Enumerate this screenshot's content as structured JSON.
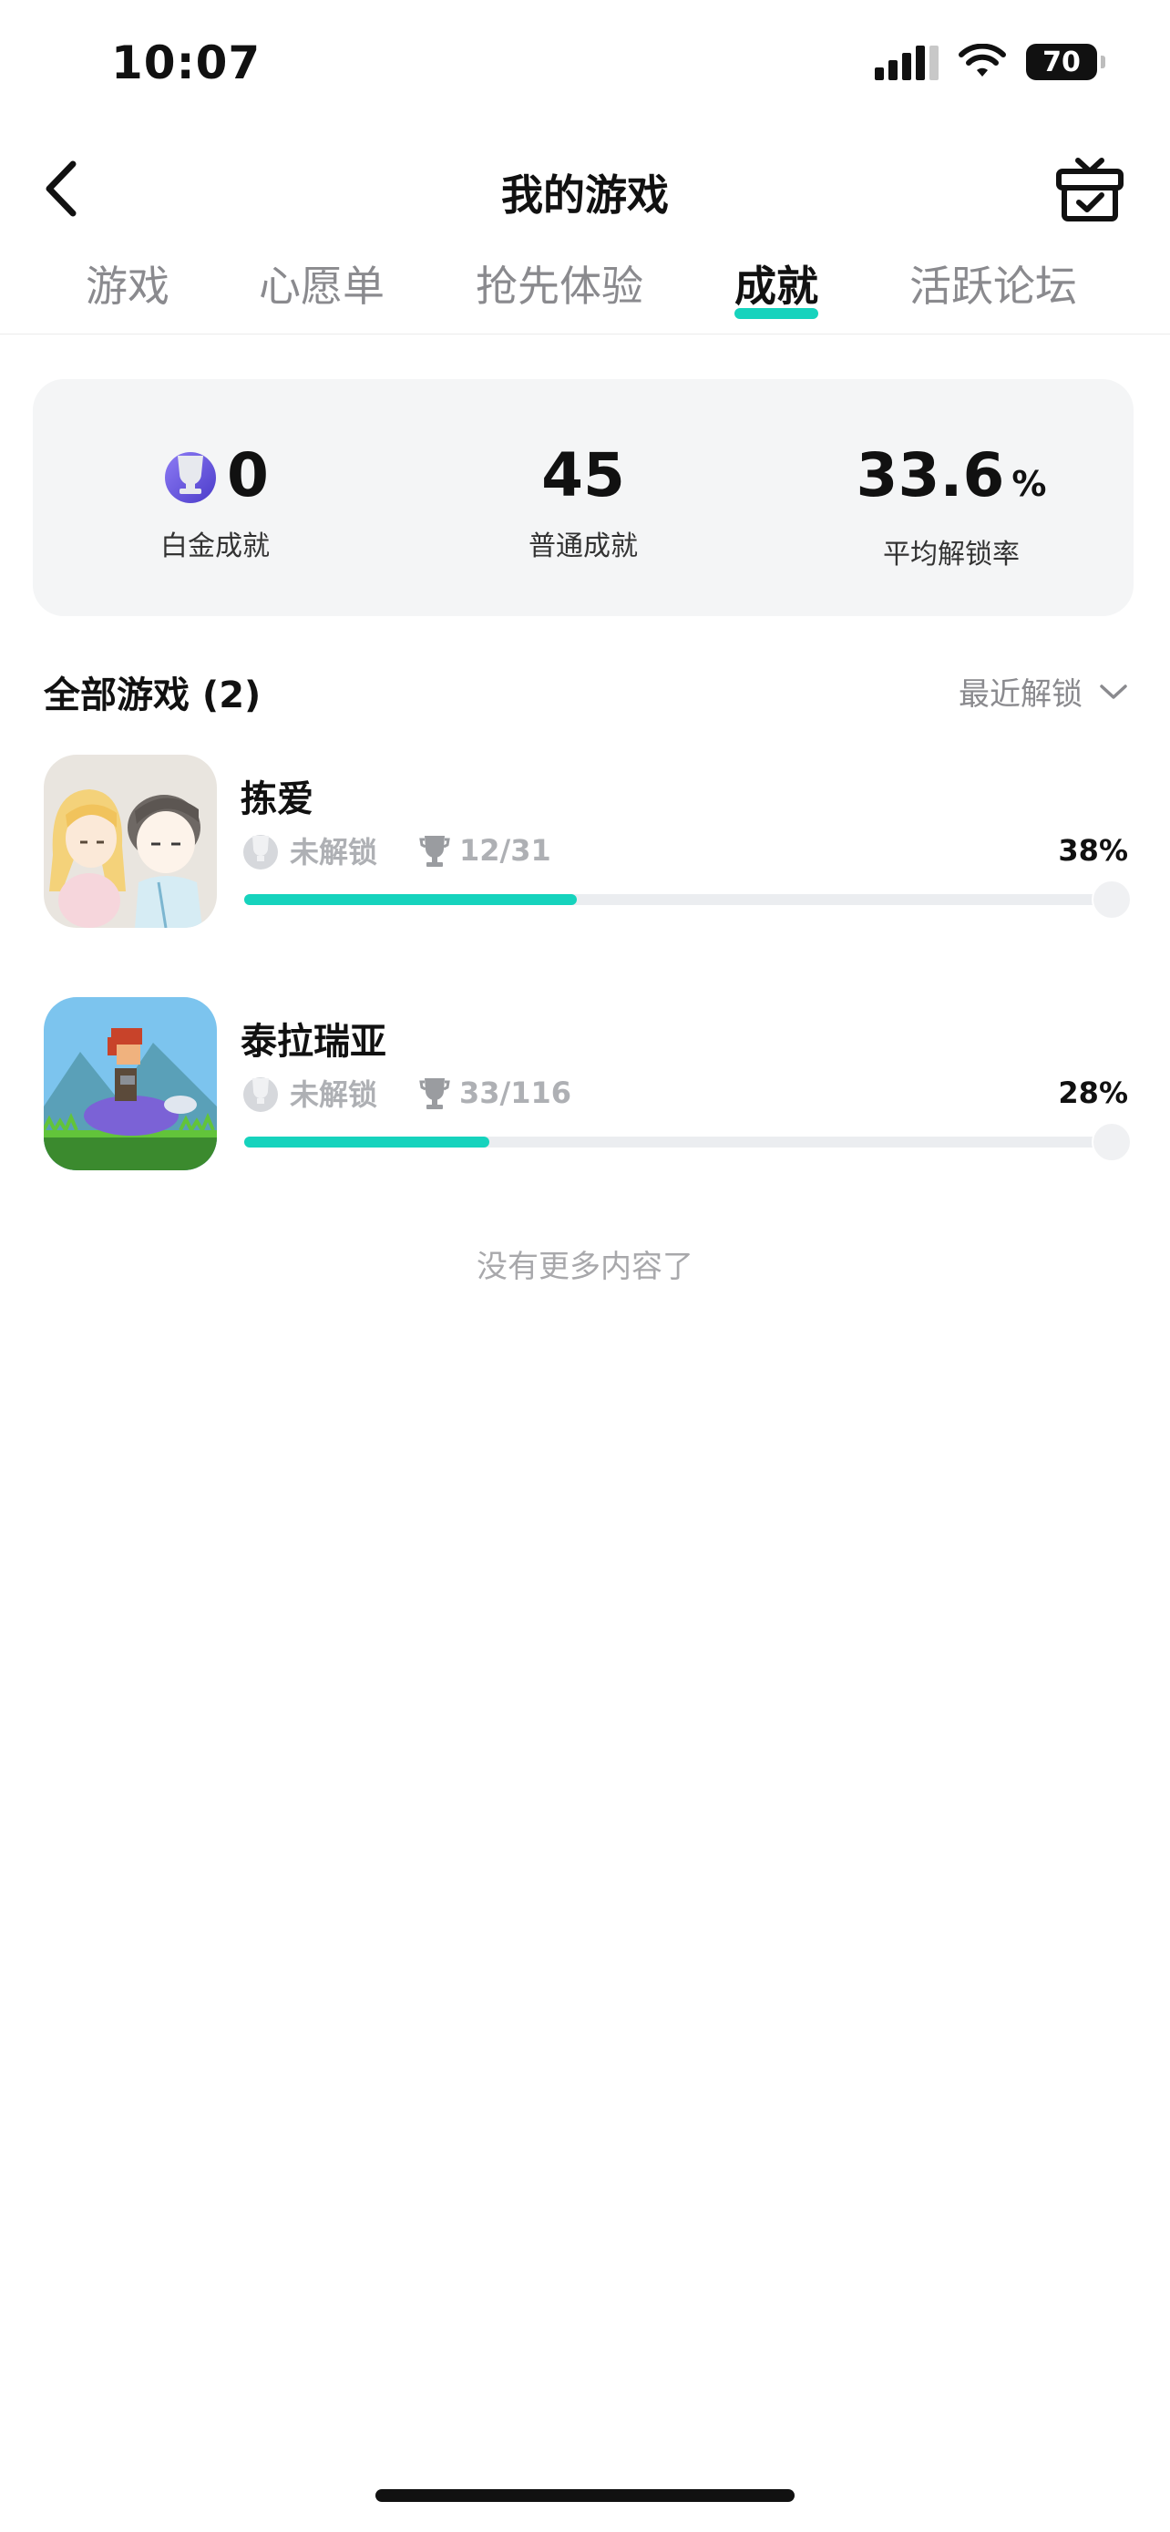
{
  "status_bar": {
    "time": "10:07",
    "battery": "70"
  },
  "nav": {
    "title": "我的游戏",
    "back_icon": "chevron-left-icon",
    "gift_icon": "gift-box-icon"
  },
  "tabs": [
    {
      "label": "游戏",
      "active": false
    },
    {
      "label": "心愿单",
      "active": false
    },
    {
      "label": "抢先体验",
      "active": false
    },
    {
      "label": "成就",
      "active": true
    },
    {
      "label": "活跃论坛",
      "active": false
    }
  ],
  "summary": {
    "platinum": {
      "value": "0",
      "label": "白金成就"
    },
    "normal": {
      "value": "45",
      "label": "普通成就"
    },
    "rate": {
      "value": "33.6",
      "unit": "%",
      "label": "平均解锁率"
    }
  },
  "list": {
    "title": "全部游戏 (2)",
    "sort_label": "最近解锁"
  },
  "games": [
    {
      "name": "拣爱",
      "platinum_status": "未解锁",
      "trophies": "12/31",
      "percent": "38%",
      "progress": 0.38
    },
    {
      "name": "泰拉瑞亚",
      "platinum_status": "未解锁",
      "trophies": "33/116",
      "percent": "28%",
      "progress": 0.28
    }
  ],
  "footer": {
    "no_more": "没有更多内容了"
  },
  "colors": {
    "accent": "#16d3bd",
    "muted": "#8a8a8e"
  }
}
